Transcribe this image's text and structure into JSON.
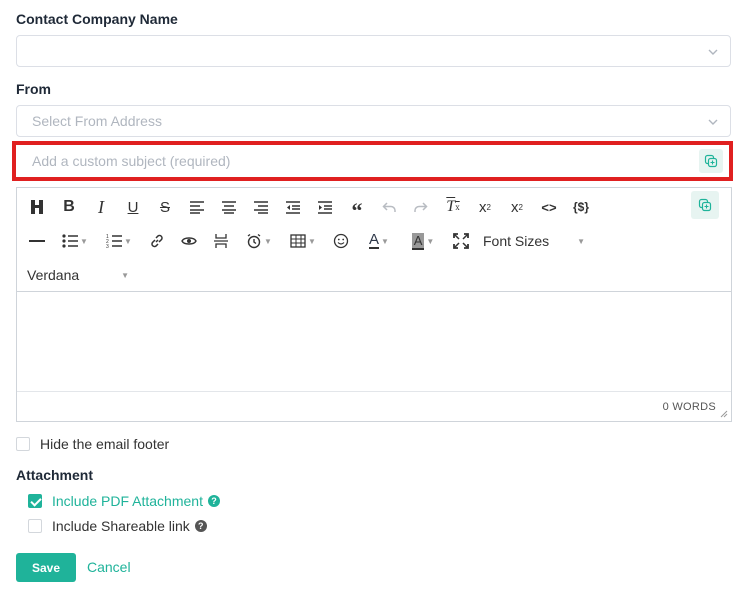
{
  "contact_company": {
    "label": "Contact Company Name",
    "value": ""
  },
  "from": {
    "label": "From",
    "placeholder": "Select From Address"
  },
  "subject": {
    "placeholder": "Add a custom subject (required)"
  },
  "editor": {
    "font_sizes_label": "Font Sizes",
    "font_family": "Verdana",
    "word_count": "0 WORDS",
    "toolbar_row1": [
      "paragraph-icon",
      "bold-icon",
      "italic-icon",
      "underline-icon",
      "strikethrough-icon",
      "align-left-icon",
      "align-center-icon",
      "align-right-icon",
      "outdent-icon",
      "indent-icon",
      "blockquote-icon",
      "undo-icon",
      "redo-icon",
      "clear-format-icon",
      "subscript-icon",
      "superscript-icon",
      "code-icon",
      "variable-icon"
    ]
  },
  "hide_footer": {
    "label": "Hide the email footer",
    "checked": false
  },
  "attachment": {
    "label": "Attachment",
    "include_pdf": {
      "label": "Include PDF Attachment",
      "checked": true
    },
    "include_link": {
      "label": "Include Shareable link",
      "checked": false
    }
  },
  "actions": {
    "save": "Save",
    "cancel": "Cancel"
  },
  "colors": {
    "accent": "#1fb39a",
    "highlight_border": "#e02020",
    "help_dark": "#555555"
  }
}
